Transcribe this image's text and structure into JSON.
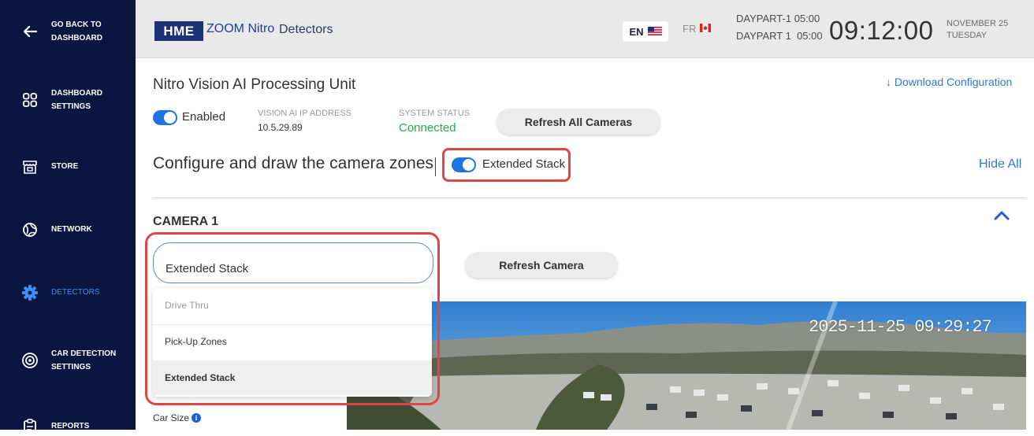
{
  "sidebar": {
    "items": [
      {
        "label": "GO BACK TO\nDASHBOARD",
        "icon": "arrow-left-icon"
      },
      {
        "label": "DASHBOARD\nSETTINGS",
        "icon": "grid-icon"
      },
      {
        "label": "STORE",
        "icon": "store-icon"
      },
      {
        "label": "NETWORK",
        "icon": "network-globe-icon"
      },
      {
        "label": "DETECTORS",
        "icon": "gear-icon",
        "active": true
      },
      {
        "label": "CAR DETECTION\nSETTINGS",
        "icon": "radar-icon"
      },
      {
        "label": "REPORTS",
        "icon": "clipboard-icon"
      }
    ]
  },
  "header": {
    "logo": "HME",
    "brand": "ZOOM Nitro",
    "page": "Detectors",
    "lang_en": "EN",
    "lang_fr": "FR",
    "daypart_1": "DAYPART-1 05:00",
    "daypart_2": "DAYPART 1  05:00",
    "time": "09:12:00",
    "date_line1": "NOVEMBER 25",
    "date_line2": "TUESDAY"
  },
  "unit": {
    "title": "Nitro Vision AI Processing Unit",
    "download_label": "Download Configuration",
    "enabled_label": "Enabled",
    "enabled": true,
    "ip_label": "VISION AI IP ADDRESS",
    "ip_value": "10.5.29.89",
    "status_label": "SYSTEM STATUS",
    "status_value": "Connected",
    "refresh_all_label": "Refresh All Cameras"
  },
  "zones": {
    "title": "Configure and draw the camera zones",
    "extended_stack_label": "Extended Stack",
    "extended_stack_on": true,
    "hide_all_label": "Hide All"
  },
  "camera": {
    "title": "CAMERA 1",
    "select_value": "Extended Stack",
    "options": [
      "Drive Thru",
      "Pick-Up Zones",
      "Extended Stack"
    ],
    "refresh_label": "Refresh Camera",
    "timestamp": "2025-11-25 09:29:27",
    "car_size_label": "Car Size",
    "info_glyph": "i"
  },
  "colors": {
    "sidebar_bg": "#0a1640",
    "accent": "#1e74e6",
    "active_nav": "#3b8ff5",
    "status_ok": "#27a84a",
    "highlight": "#e04447"
  }
}
